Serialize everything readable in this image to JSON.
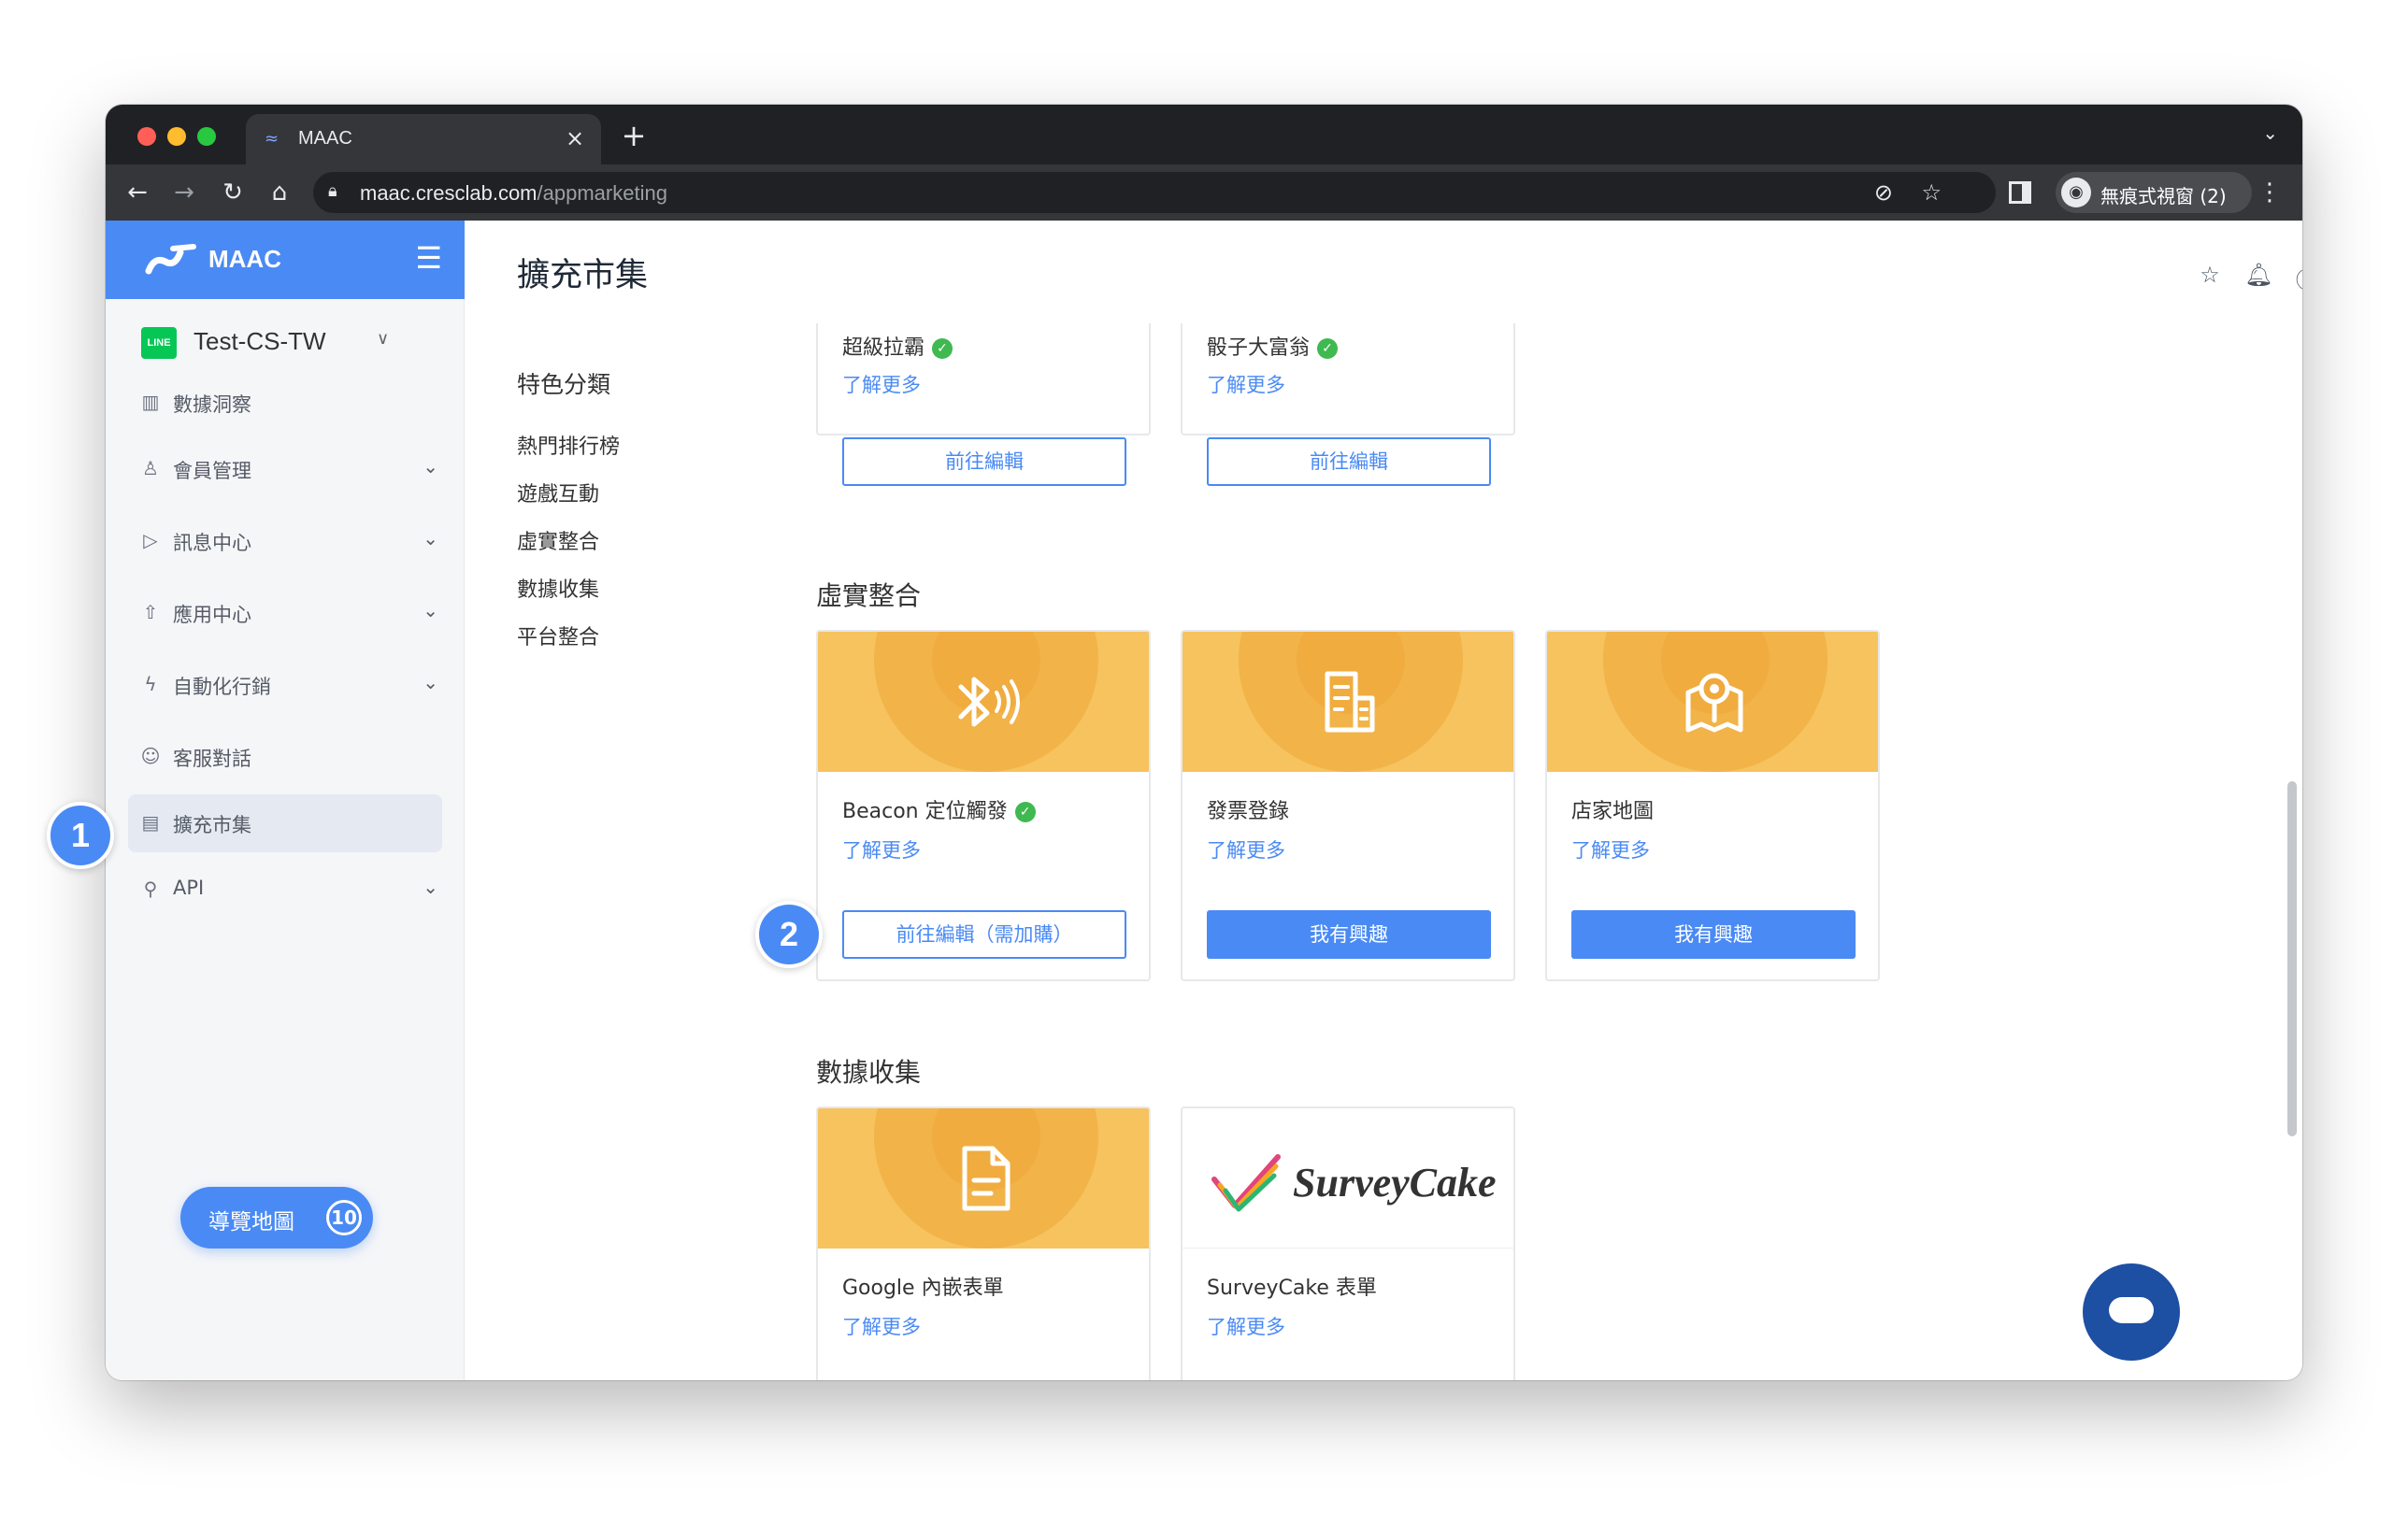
{
  "browser": {
    "tab_title": "MAAC",
    "url_host": "maac.cresclab.com",
    "url_path": "/appmarketing",
    "profile_label": "無痕式視窗 (2)"
  },
  "app": {
    "brand": "MAAC",
    "account": "Test-CS-TW",
    "line_badge": "LINE",
    "nav": [
      {
        "label": "數據洞察",
        "icon": "chart-icon"
      },
      {
        "label": "會員管理",
        "icon": "user-icon"
      },
      {
        "label": "訊息中心",
        "icon": "send-icon"
      },
      {
        "label": "應用中心",
        "icon": "rocket-icon"
      },
      {
        "label": "自動化行銷",
        "icon": "lightning-icon"
      },
      {
        "label": "客服對話",
        "icon": "chat-icon"
      },
      {
        "label": "擴充市集",
        "icon": "store-icon"
      },
      {
        "label": "API",
        "icon": "link-icon"
      }
    ],
    "guide_button": {
      "label": "導覽地圖",
      "count": "10"
    }
  },
  "page": {
    "title": "擴充市集",
    "category_title": "特色分類",
    "categories": [
      "熱門排行榜",
      "遊戲互動",
      "虛實整合",
      "數據收集",
      "平台整合"
    ]
  },
  "top_cards": [
    {
      "name": "超級拉霸",
      "more": "了解更多",
      "button": "前往編輯"
    },
    {
      "name": "骰子大富翁",
      "more": "了解更多",
      "button": "前往編輯"
    }
  ],
  "sections": [
    {
      "title": "虛實整合",
      "cards": [
        {
          "name": "Beacon 定位觸發",
          "more": "了解更多",
          "button": "前往編輯（需加購）",
          "icon": "bluetooth-beacon-icon",
          "verified": true
        },
        {
          "name": "發票登錄",
          "more": "了解更多",
          "button": "我有興趣",
          "icon": "receipt-icon"
        },
        {
          "name": "店家地圖",
          "more": "了解更多",
          "button": "我有興趣",
          "icon": "map-pin-icon"
        }
      ]
    },
    {
      "title": "數據收集",
      "cards": [
        {
          "name": "Google 內嵌表單",
          "more": "了解更多",
          "icon": "document-icon"
        },
        {
          "name": "SurveyCake 表單",
          "more": "了解更多",
          "logo_text": "SurveyCake"
        }
      ]
    }
  ],
  "callouts": [
    "1",
    "2"
  ]
}
